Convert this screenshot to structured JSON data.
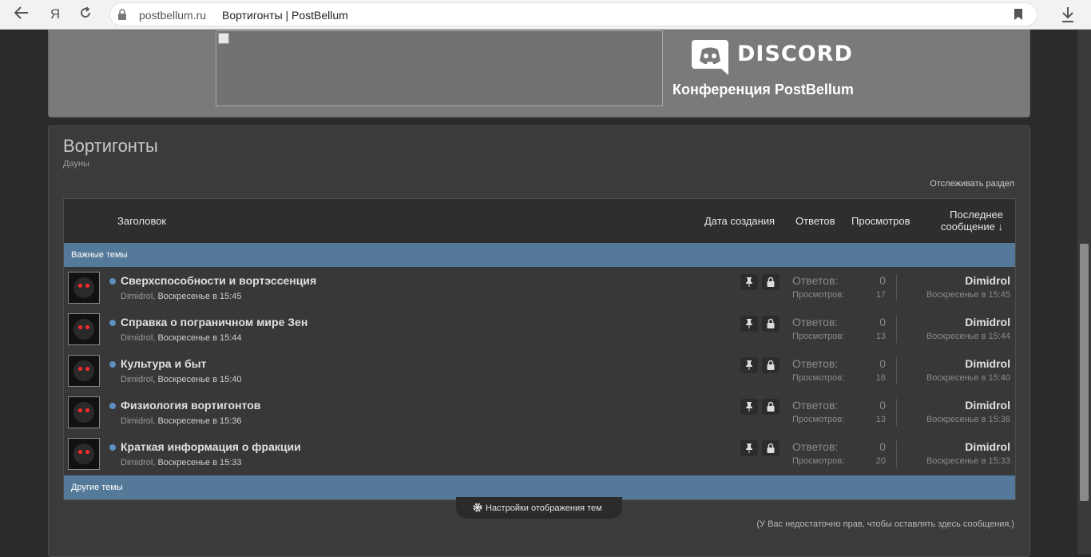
{
  "browser": {
    "url": "postbellum.ru",
    "page_title": "Вортигонты | PostBellum",
    "yandex_label": "Я"
  },
  "banner": {
    "discord_word": "DISCORD",
    "discord_caption": "Конференция PostBellum"
  },
  "forum": {
    "title": "Вортигонты",
    "description": "Дауны",
    "watch_label": "Отслеживать раздел",
    "columns": {
      "title": "Заголовок",
      "created": "Дата создания",
      "replies": "Ответов",
      "views": "Просмотров",
      "last_line1": "Последнее",
      "last_line2": "сообщение ↓"
    },
    "sticky_section": "Важные темы",
    "other_section": "Другие темы",
    "threads": [
      {
        "title": "Сверхспособности и вортэссенция",
        "author": "Dimidrol",
        "date": "Воскресенье в 15:45",
        "replies_label": "Ответов:",
        "replies": "0",
        "views_label": "Просмотров:",
        "views": "17",
        "last_user": "Dimidrol",
        "last_date": "Воскресенье в 15:45"
      },
      {
        "title": "Справка о пограничном мире Зен",
        "author": "Dimidrol",
        "date": "Воскресенье в 15:44",
        "replies_label": "Ответов:",
        "replies": "0",
        "views_label": "Просмотров:",
        "views": "13",
        "last_user": "Dimidrol",
        "last_date": "Воскресенье в 15:44"
      },
      {
        "title": "Культура и быт",
        "author": "Dimidrol",
        "date": "Воскресенье в 15:40",
        "replies_label": "Ответов:",
        "replies": "0",
        "views_label": "Просмотров:",
        "views": "16",
        "last_user": "Dimidrol",
        "last_date": "Воскресенье в 15:40"
      },
      {
        "title": "Физиология вортигонтов",
        "author": "Dimidrol",
        "date": "Воскресенье в 15:36",
        "replies_label": "Ответов:",
        "replies": "0",
        "views_label": "Просмотров:",
        "views": "13",
        "last_user": "Dimidrol",
        "last_date": "Воскресенье в 15:36"
      },
      {
        "title": "Краткая информация о фракции",
        "author": "Dimidrol",
        "date": "Воскресенье в 15:33",
        "replies_label": "Ответов:",
        "replies": "0",
        "views_label": "Просмотров:",
        "views": "20",
        "last_user": "Dimidrol",
        "last_date": "Воскресенье в 15:33"
      }
    ],
    "settings_label": "Настройки отображения тем",
    "no_permission": "(У Вас недостаточно прав, чтобы оставлять здесь сообщения.)"
  },
  "icons": [
    "back-icon",
    "yandex-icon",
    "reload-icon",
    "lock-icon",
    "bookmark-icon",
    "download-icon",
    "discord-logo-icon",
    "pin-icon",
    "locked-icon",
    "gear-icon"
  ],
  "colors": {
    "section_bar": "#557a99",
    "banner_bg": "#7a7a7a",
    "page_bg": "#2b2b2b"
  }
}
